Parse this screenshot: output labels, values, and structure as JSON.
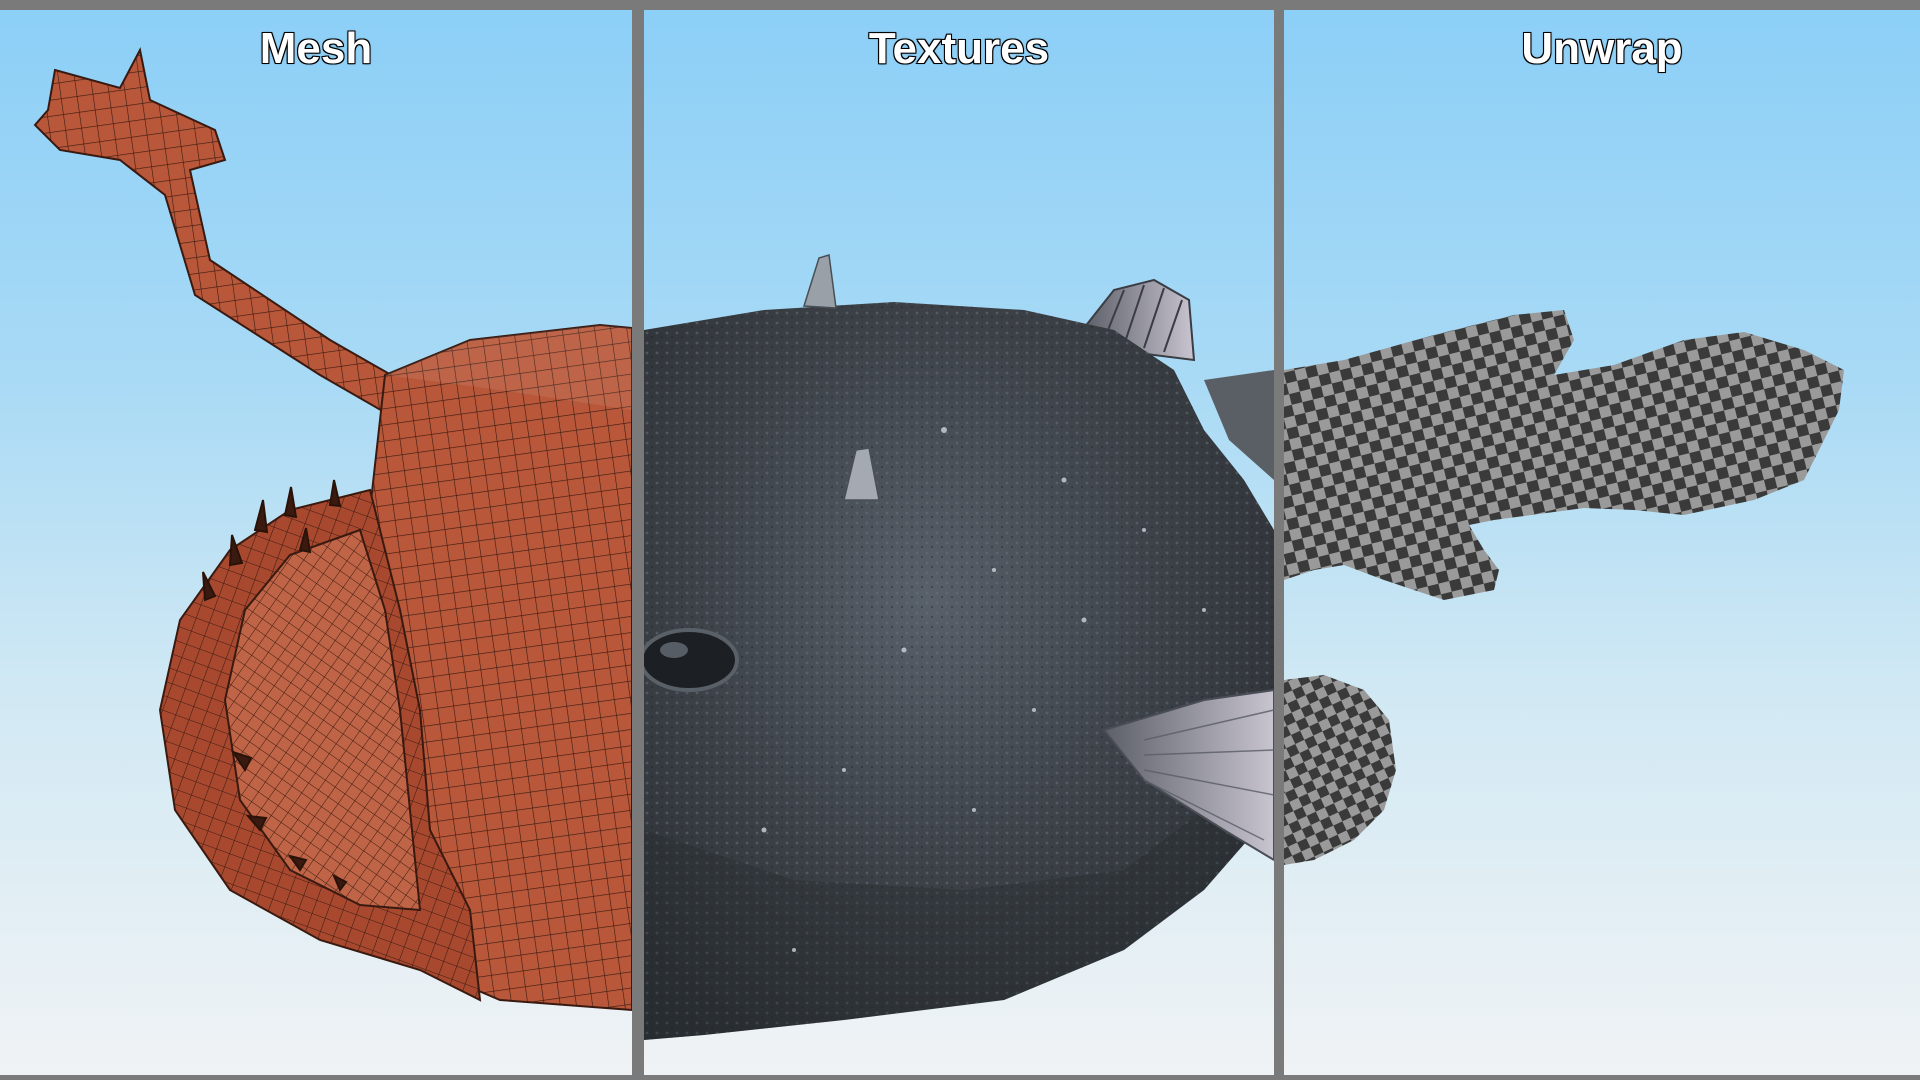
{
  "panels": [
    {
      "id": "mesh",
      "title": "Mesh"
    },
    {
      "id": "textures",
      "title": "Textures"
    },
    {
      "id": "unwrap",
      "title": "Unwrap"
    }
  ],
  "colors": {
    "divider": "#7a7a7a",
    "sky_top": "#8ccff7",
    "sky_bottom": "#f0f3f5",
    "mesh_fill": "#b8573a",
    "mesh_wire": "#3a1a10",
    "skin_dark": "#3c4147",
    "checker_dark": "#3a3a3a",
    "checker_light": "#9a9a9a"
  }
}
